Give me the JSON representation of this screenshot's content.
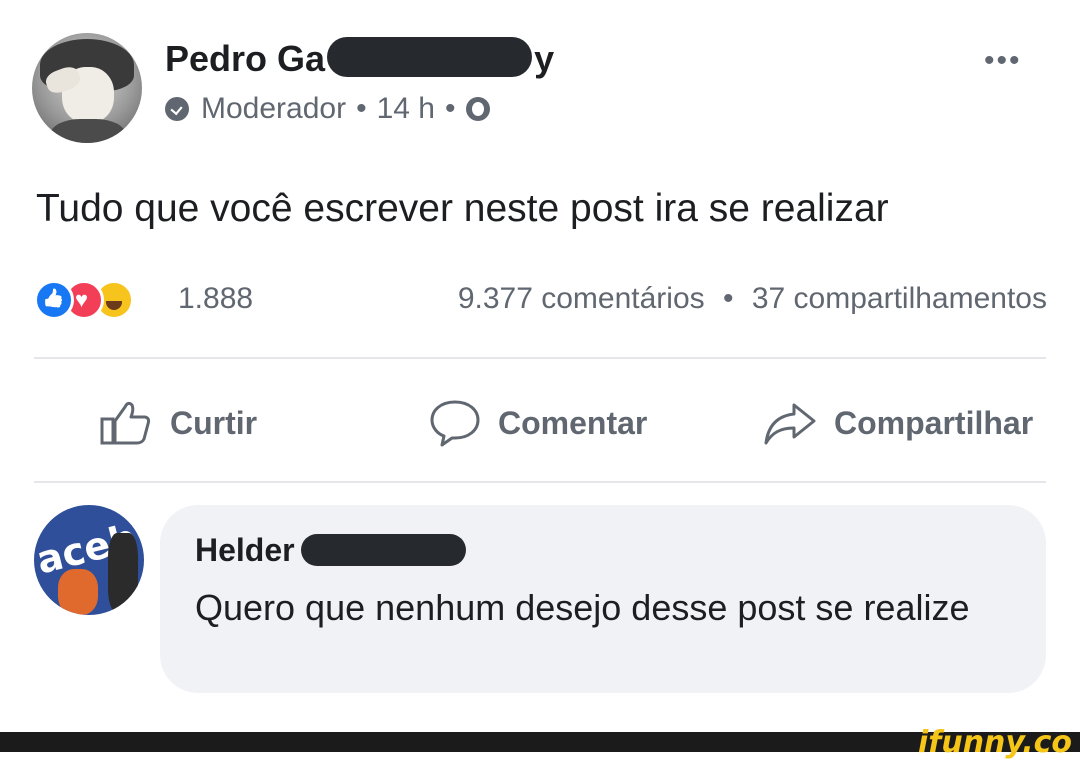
{
  "post": {
    "author_visible": "Pedro Ga",
    "author_tail": "y",
    "role": "Moderador",
    "separator": "•",
    "time": "14 h",
    "more_label": "•••",
    "text": "Tudo que você escrever neste post ira se realizar",
    "reactions": {
      "count": "1.888",
      "types": [
        "like",
        "love",
        "haha"
      ]
    },
    "comments_count": "9.377 comentários",
    "shares_count": "37 compartilhamentos"
  },
  "actions": {
    "like": "Curtir",
    "comment": "Comentar",
    "share": "Compartilhar"
  },
  "comment": {
    "author_visible": "Helder",
    "text": "Quero que nenhum desejo desse post se realize",
    "avatar_text": "aceb"
  },
  "watermark": "ifunny.co",
  "colors": {
    "text": "#1c1e21",
    "secondary": "#606770",
    "like_blue": "#1877f2",
    "love_red": "#f33e58",
    "haha_yellow": "#f7c31d",
    "bubble": "#f0f2f5"
  }
}
